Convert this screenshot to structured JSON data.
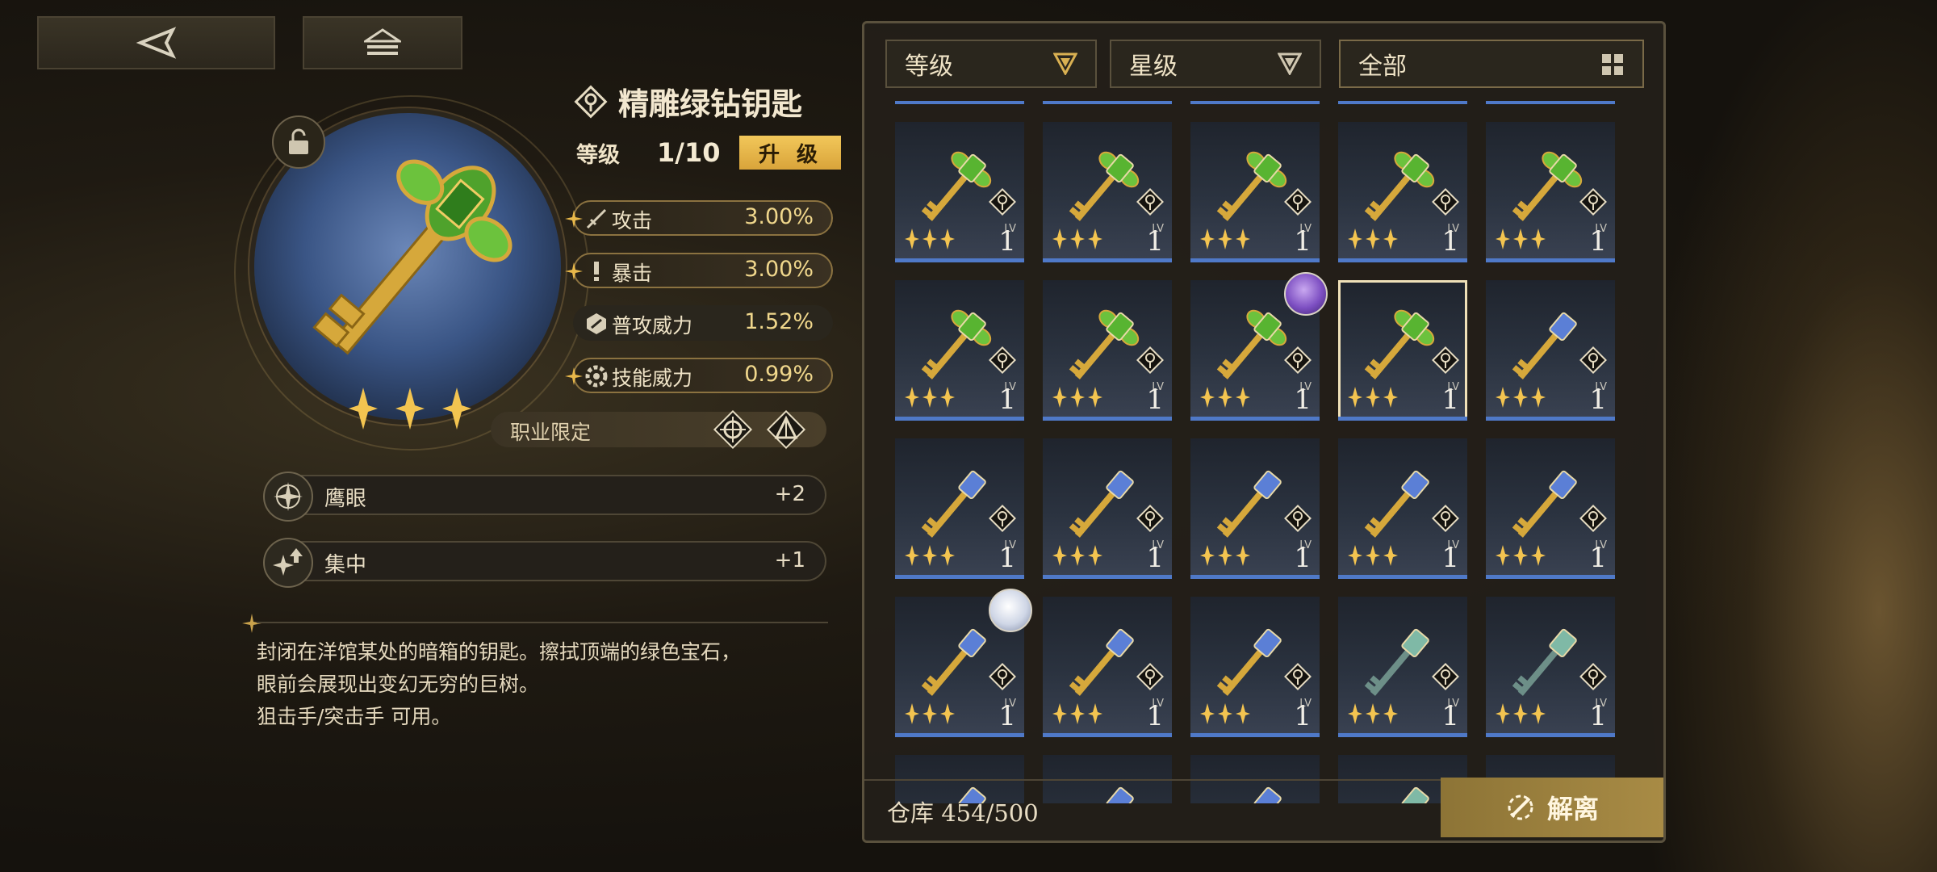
{
  "item": {
    "name": "精雕绿钻钥匙",
    "level_label": "等级",
    "level_value": "1/10",
    "upgrade_label": "升 级",
    "stars": 3
  },
  "stats": [
    {
      "name": "攻击",
      "value": "3.00%",
      "highlight": true
    },
    {
      "name": "暴击",
      "value": "3.00%",
      "highlight": true
    },
    {
      "name": "普攻威力",
      "value": "1.52%",
      "highlight": false
    },
    {
      "name": "技能威力",
      "value": "0.99%",
      "highlight": true
    }
  ],
  "job_limit_label": "职业限定",
  "skills": [
    {
      "name": "鹰眼",
      "value": "+2"
    },
    {
      "name": "集中",
      "value": "+1"
    }
  ],
  "description": [
    "封闭在洋馆某处的暗箱的钥匙。擦拭顶端的绿色宝石，",
    "眼前会展现出变幻无穷的巨树。",
    "狙击手/突击手 可用。"
  ],
  "filters": {
    "level": "等级",
    "star": "星级",
    "all": "全部"
  },
  "inventory": {
    "lv_tag": "LV",
    "cells": [
      {
        "type": "green",
        "level": "1"
      },
      {
        "type": "green",
        "level": "1"
      },
      {
        "type": "green",
        "level": "1"
      },
      {
        "type": "green",
        "level": "1"
      },
      {
        "type": "green",
        "level": "1"
      },
      {
        "type": "green",
        "level": "1"
      },
      {
        "type": "green",
        "level": "1"
      },
      {
        "type": "green",
        "level": "1",
        "avatar": "purple"
      },
      {
        "type": "green",
        "level": "1",
        "selected": true
      },
      {
        "type": "blue",
        "level": "1"
      },
      {
        "type": "blue",
        "level": "1"
      },
      {
        "type": "blue",
        "level": "1"
      },
      {
        "type": "blue",
        "level": "1"
      },
      {
        "type": "blue",
        "level": "1"
      },
      {
        "type": "blue",
        "level": "1"
      },
      {
        "type": "blue",
        "level": "1",
        "avatar": "white"
      },
      {
        "type": "blue",
        "level": "1"
      },
      {
        "type": "blue",
        "level": "1"
      },
      {
        "type": "teal",
        "level": "1"
      },
      {
        "type": "teal",
        "level": "1"
      }
    ],
    "capacity": "仓库 454/500",
    "dismantle_label": "解离"
  },
  "colors": {
    "accent_gold": "#d9a43a",
    "cell_bar": "#4f79c8",
    "stat_value": "#f0d78c"
  }
}
